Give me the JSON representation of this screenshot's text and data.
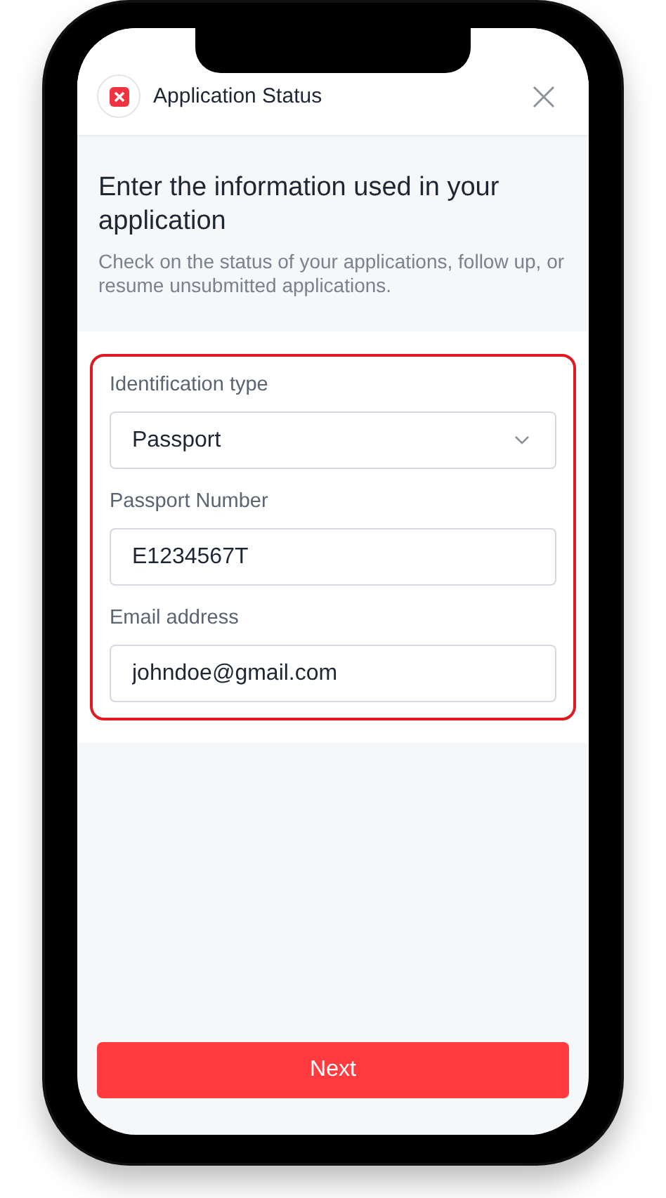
{
  "header": {
    "title": "Application Status"
  },
  "intro": {
    "heading": "Enter the information used in your application",
    "subheading": "Check on the status of your applications, follow up, or resume unsubmitted applications."
  },
  "form": {
    "highlighted": true,
    "fields": [
      {
        "kind": "select",
        "label": "Identification type",
        "value": "Passport"
      },
      {
        "kind": "text",
        "label": "Passport Number",
        "value": "E1234567T"
      },
      {
        "kind": "text",
        "label": "Email address",
        "value": "johndoe@gmail.com"
      }
    ]
  },
  "next_button": {
    "label": "Next"
  }
}
